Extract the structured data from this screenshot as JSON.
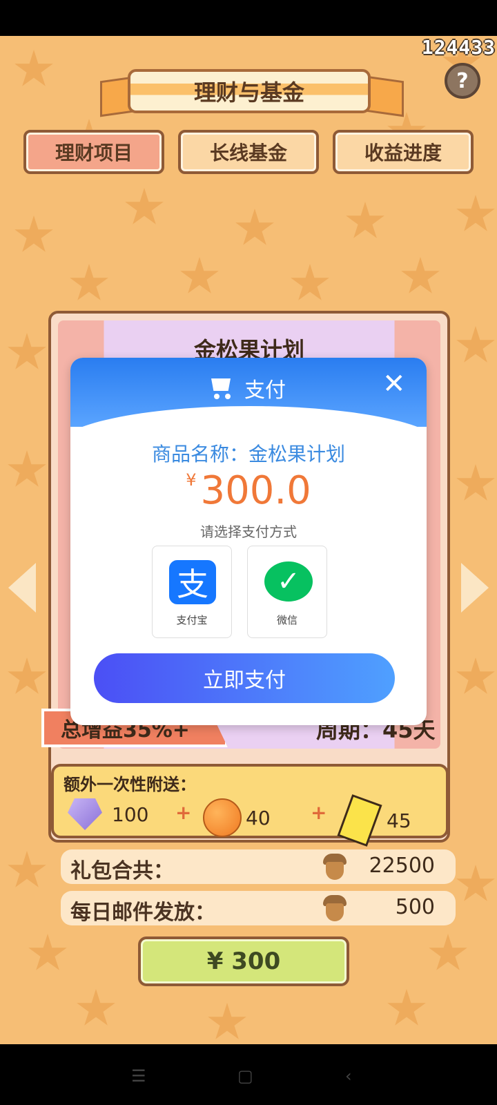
{
  "hud": {
    "score": "124433",
    "help_icon": "?"
  },
  "title": "理财与基金",
  "tabs": [
    {
      "label": "理财项目",
      "active": true
    },
    {
      "label": "长线基金",
      "active": false
    },
    {
      "label": "收益进度",
      "active": false
    }
  ],
  "card": {
    "title": "金松果计划",
    "total_gain": "总增益35%+",
    "period": "周期：45天"
  },
  "bonus": {
    "label": "额外一次性附送：",
    "items": [
      {
        "icon": "gem-icon",
        "value": "100"
      },
      {
        "icon": "orange-icon",
        "value": "40"
      },
      {
        "icon": "ticket-icon",
        "value": "45"
      }
    ],
    "plus": "+"
  },
  "summary": {
    "total_label": "礼包合共：",
    "total_value": "22500",
    "daily_label": "每日邮件发放：",
    "daily_value": "500"
  },
  "buy_button": "¥ 300",
  "payment": {
    "title": "支付",
    "close": "✕",
    "product_line": "商品名称：金松果计划",
    "currency": "¥",
    "amount": "300.0",
    "choose_text": "请选择支付方式",
    "methods": [
      {
        "label": "支付宝",
        "icon_char": "支"
      },
      {
        "label": "微信",
        "icon_char": "✓"
      }
    ],
    "pay_now": "立即支付"
  },
  "navbar": {
    "menu": "☰",
    "home": "▢",
    "back": "‹"
  },
  "colors": {
    "background": "#f6be75",
    "accent_blue": "#2a7df0",
    "price_orange": "#f07838",
    "buy_green": "#d4e67a"
  }
}
